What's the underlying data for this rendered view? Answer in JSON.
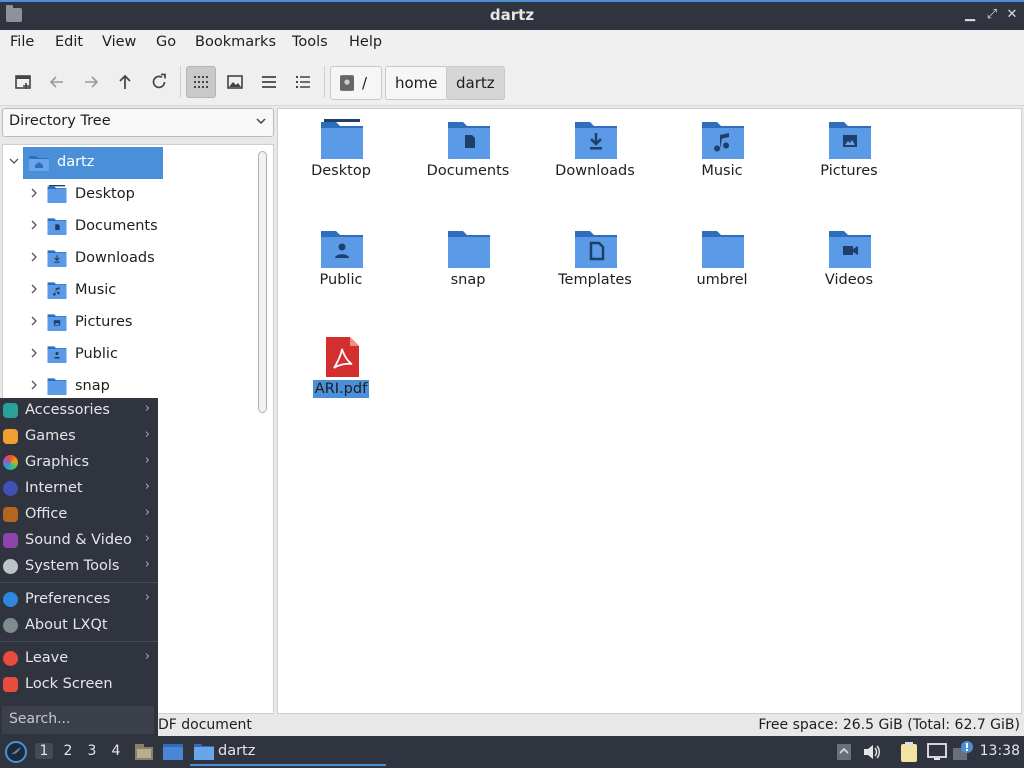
{
  "window": {
    "title": "dartz"
  },
  "menubar": [
    "File",
    "Edit",
    "View",
    "Go",
    "Bookmarks",
    "Tools",
    "Help"
  ],
  "breadcrumb": {
    "root": "/",
    "items": [
      "home",
      "dartz"
    ]
  },
  "side_pane": {
    "mode": "Directory Tree"
  },
  "tree": {
    "root": "dartz",
    "children": [
      "Desktop",
      "Documents",
      "Downloads",
      "Music",
      "Pictures",
      "Public",
      "snap"
    ]
  },
  "files": [
    {
      "name": "Desktop",
      "icon": "desktop-folder-icon"
    },
    {
      "name": "Documents",
      "icon": "documents-folder-icon"
    },
    {
      "name": "Downloads",
      "icon": "downloads-folder-icon"
    },
    {
      "name": "Music",
      "icon": "music-folder-icon"
    },
    {
      "name": "Pictures",
      "icon": "pictures-folder-icon"
    },
    {
      "name": "Public",
      "icon": "public-folder-icon"
    },
    {
      "name": "snap",
      "icon": "folder-icon"
    },
    {
      "name": "Templates",
      "icon": "templates-folder-icon"
    },
    {
      "name": "umbrel",
      "icon": "folder-icon"
    },
    {
      "name": "Videos",
      "icon": "videos-folder-icon"
    },
    {
      "name": "ARI.pdf",
      "icon": "pdf-file-icon",
      "selected": true
    }
  ],
  "status": {
    "left": "DF document",
    "right": "Free space: 26.5 GiB (Total: 62.7 GiB)"
  },
  "start_menu": {
    "items": [
      "Accessories",
      "Games",
      "Graphics",
      "Internet",
      "Office",
      "Sound & Video",
      "System Tools"
    ],
    "prefs": [
      "Preferences",
      "About LXQt"
    ],
    "session": [
      "Leave",
      "Lock Screen"
    ],
    "search_placeholder": "Search..."
  },
  "taskbar": {
    "workspaces": [
      "1",
      "2",
      "3",
      "4"
    ],
    "active_workspace": "1",
    "task": "dartz",
    "clock": "13:38"
  },
  "colors": {
    "accent": "#4a90d9",
    "folder": "#4a86d8",
    "panel": "#2f343f",
    "pdf": "#d32f2f"
  }
}
